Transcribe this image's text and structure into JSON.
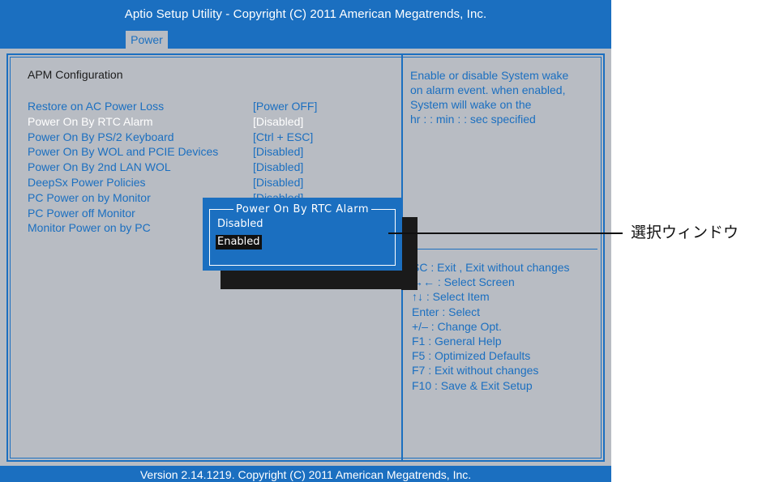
{
  "header": {
    "title": "Aptio  Setup  Utility - Copyright  (C)  2011  American  Megatrends,  Inc.",
    "active_tab": "Power"
  },
  "main": {
    "section_title": "APM  Configuration",
    "items": [
      {
        "label": "Restore  on  AC  Power  Loss",
        "value": "[Power  OFF]"
      },
      {
        "label": "Power  On  By  RTC  Alarm",
        "value": "[Disabled]"
      },
      {
        "label": "Power On By PS/2 Keyboard",
        "value": "[Ctrl + ESC]"
      },
      {
        "label": "Power On By WOL and PCIE Devices",
        "value": "[Disabled]"
      },
      {
        "label": "Power On By 2nd LAN WOL",
        "value": "[Disabled]"
      },
      {
        "label": "DeepSx Power Policies",
        "value": "[Disabled]"
      },
      {
        "label": "PC Power on by Monitor",
        "value": "[Disabled]"
      },
      {
        "label": "PC Power off Monitor",
        "value": ""
      },
      {
        "label": "Monitor Power on by PC",
        "value": ""
      }
    ],
    "selected_index": 1
  },
  "help": {
    "text": "Enable  or  disable  System  wake\non  alarm event. when  enabled,\nSystem  will  wake  on  the\nhr : : min : : sec  specified",
    "keys": [
      {
        "key": "ESC",
        "desc": "SC :  Exit ,  Exit  without  changes"
      },
      {
        "key": "screen-arrows",
        "desc": "→← :  Select  Screen"
      },
      {
        "key": "item-arrows",
        "desc": "↑↓ :  Select  Item"
      },
      {
        "key": "Enter",
        "desc": "Enter :  Select"
      },
      {
        "key": "+/-",
        "desc": "+/– :  Change  Opt."
      },
      {
        "key": "F1",
        "desc": "F1 :  General  Help"
      },
      {
        "key": "F5",
        "desc": "F5 :  Optimized  Defaults"
      },
      {
        "key": "F7",
        "desc": "F7 :  Exit  without  changes"
      },
      {
        "key": "F10",
        "desc": "F10 :  Save  &  Exit  Setup"
      }
    ]
  },
  "popup": {
    "title": "Power  On  By  RTC  Alarm",
    "options": [
      "Disabled",
      "Enabled"
    ],
    "highlighted": "Enabled"
  },
  "footer": {
    "text": "Version  2.14.1219. Copyright  (C)  2011  American  Megatrends,  Inc."
  },
  "annotation": {
    "label": "選択ウィンドウ"
  },
  "colors": {
    "accent": "#1b6fc0",
    "background": "#b8bcc3",
    "shadow": "#1a1a1a"
  }
}
